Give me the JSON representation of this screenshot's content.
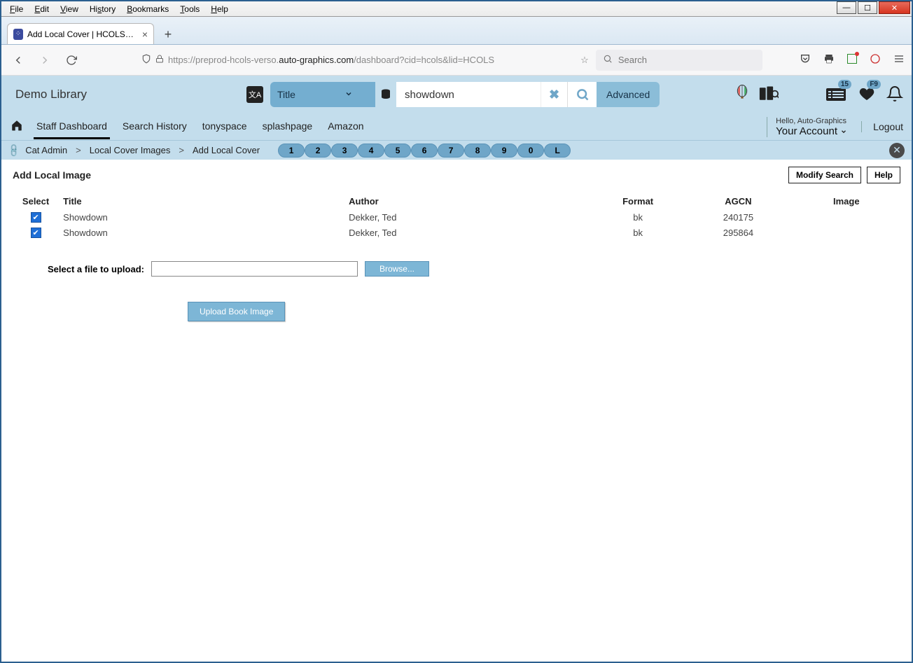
{
  "browser": {
    "menu": [
      "File",
      "Edit",
      "View",
      "History",
      "Bookmarks",
      "Tools",
      "Help"
    ],
    "tab_title": "Add Local Cover | HCOLS | HCO",
    "url_prefix": "https://preprod-hcols-verso.",
    "url_bold": "auto-graphics.com",
    "url_suffix": "/dashboard?cid=hcols&lid=HCOLS",
    "search_placeholder": "Search"
  },
  "header": {
    "brand": "Demo Library",
    "search_field_label": "Title",
    "search_value": "showdown",
    "advanced_label": "Advanced",
    "list_badge": "15",
    "heart_badge": "F9"
  },
  "nav": {
    "items": [
      "Staff Dashboard",
      "Search History",
      "tonyspace",
      "splashpage",
      "Amazon"
    ],
    "greeting": "Hello, Auto-Graphics",
    "account_label": "Your Account",
    "logout": "Logout"
  },
  "crumbs": {
    "parts": [
      "Cat Admin",
      "Local Cover Images",
      "Add Local Cover"
    ],
    "pages": [
      "1",
      "2",
      "3",
      "4",
      "5",
      "6",
      "7",
      "8",
      "9",
      "0",
      "L"
    ]
  },
  "main": {
    "title": "Add Local Image",
    "modify_btn": "Modify Search",
    "help_btn": "Help",
    "columns": {
      "select": "Select",
      "title": "Title",
      "author": "Author",
      "format": "Format",
      "agcn": "AGCN",
      "image": "Image"
    },
    "rows": [
      {
        "checked": true,
        "title": "Showdown",
        "author": "Dekker, Ted",
        "format": "bk",
        "agcn": "240175"
      },
      {
        "checked": true,
        "title": "Showdown",
        "author": "Dekker, Ted",
        "format": "bk",
        "agcn": "295864"
      }
    ],
    "upload_label": "Select a file to upload:",
    "browse_label": "Browse...",
    "upload_btn": "Upload Book Image"
  }
}
